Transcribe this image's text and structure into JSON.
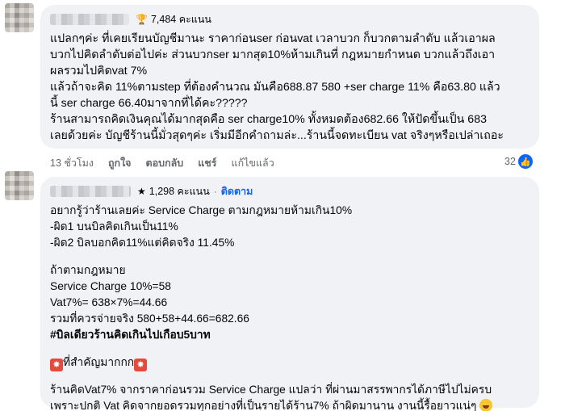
{
  "comment1": {
    "badge_points": "7,484 คะแนน",
    "lines": [
      "แปลกๆค่ะ ที่เคยเรียนบัญชีมานะ ราคาก่อนser ก่อนvat เวลาบวก ก็บวกตามลำดับ แล้วเอาผล",
      "บวกไปคิดลำดับต่อไปค่ะ ส่วนบวกser มากสุด10%ห้ามเกินที่ กฎหมายกำหนด บวกแล้วถึงเอา",
      "ผลรวมไปคิดvat 7%",
      "แล้วถ้าจะคิด 11%ตามstep ที่ต้องคำนวณ มันคือ688.87 580 +ser charge 11% คือ63.80 แล้ว",
      "นี้ ser charge 66.40มาจากที่ได้คะ?????",
      "ร้านสามารถคิดเงินคุณได้มากสุดคือ ser charge10% ทั้งหมดต้อง682.66 ให้ปัดขึ้นเป็น 683",
      "เลยด้วยค่ะ บัญชีร้านนี้มั่วสุดๆค่ะ เริ่มมีอีกคำถามล่ะ...ร้านนี้จดทะเบียน vat จริงๆหรือเปล่าเถอะ"
    ],
    "actions": {
      "time": "13 ชั่วโมง",
      "like": "ถูกใจ",
      "reply": "ตอบกลับ",
      "share": "แชร์",
      "edited": "แก้ไขแล้ว"
    },
    "reaction_count": "32"
  },
  "comment2": {
    "badge_points": "1,298 คะแนน",
    "follow": "ติดตาม",
    "lines": [
      "อยากรู้ว่าร้านเลยค่ะ Service Charge ตามกฎหมายห้ามเกิน10%",
      "-ผิด1 บนบิลคิดเกินเป็น11%",
      "-ผิด2 บิลบอกคิด11%แต่คิดจริง 11.45%",
      "",
      "ถ้าตามกฎหมาย",
      "Service Charge 10%=58",
      "Vat7%= 638×7%=44.66",
      "รวมที่ควรจ่ายจริง 580+58+44.66=682.66",
      "#บิลเดียวร้านคิดเกินไปเกือบ5บาท",
      "",
      "ที่สำคัญมากกก",
      "",
      "ร้านคิดVat7% จากราคาก่อนรวม Service Charge แปลว่า ที่ผ่านมาสรรพากรได้ภาษีไปไม่ครบ",
      "เพราะปกติ Vat คิดจากยอดรวมทุกอย่างที่เป็นรายได้ร้าน7% ถ้าผิดมานาน งานนี้รื้อยาวแน่ๆ"
    ]
  }
}
